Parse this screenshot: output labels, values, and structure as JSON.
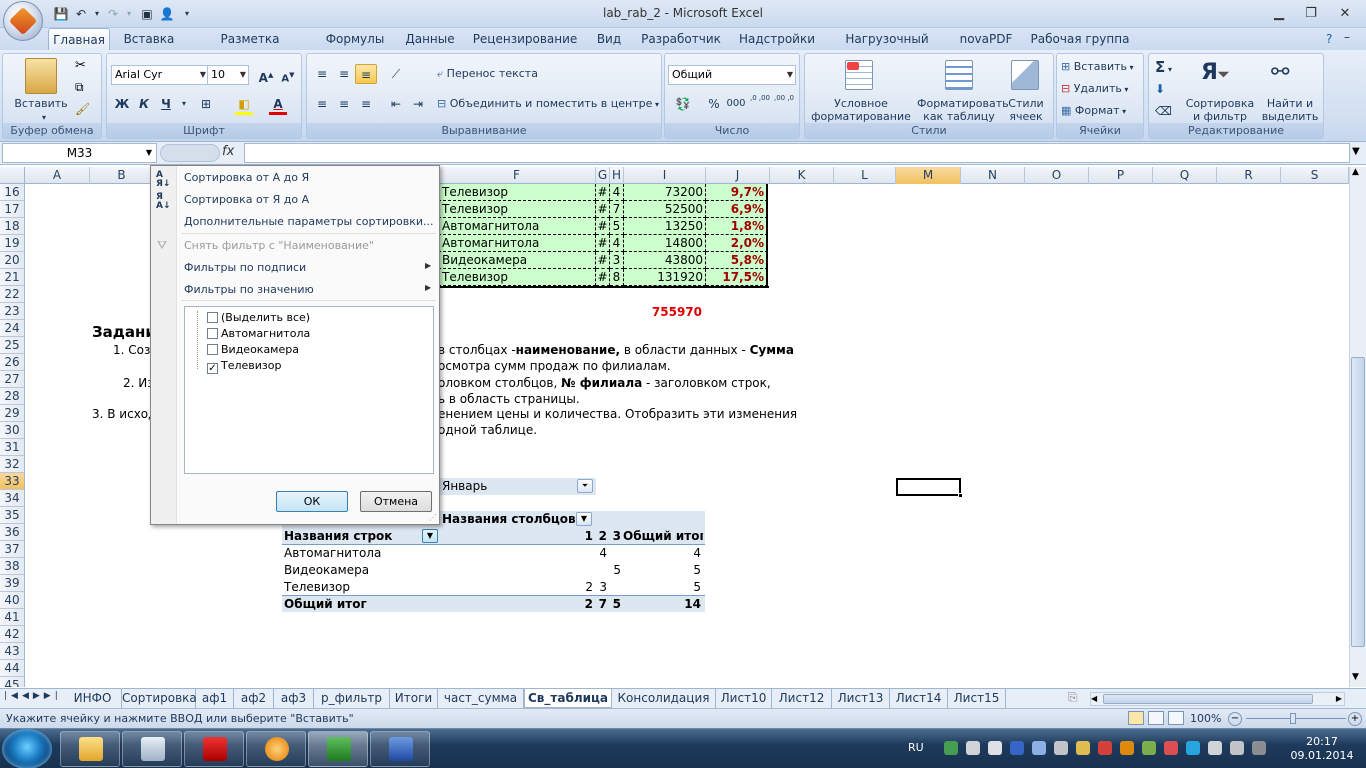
{
  "window": {
    "title": "lab_rab_2 - Microsoft Excel",
    "qat": [
      "save",
      "undo",
      "redo",
      "print-preview",
      "user"
    ]
  },
  "ribbon": {
    "tabs": [
      "Главная",
      "Вставка",
      "Разметка страницы",
      "Формулы",
      "Данные",
      "Рецензирование",
      "Вид",
      "Разработчик",
      "Надстройки",
      "Нагрузочный тест",
      "novaPDF",
      "Рабочая группа"
    ],
    "active_tab": "Главная",
    "groups": {
      "clipboard": {
        "label": "Буфер обмена",
        "paste": "Вставить"
      },
      "font": {
        "label": "Шрифт",
        "font_name": "Arial Cyr",
        "font_size": "10",
        "bold": "Ж",
        "italic": "К",
        "underline": "Ч"
      },
      "alignment": {
        "label": "Выравнивание",
        "wrap": "Перенос текста",
        "merge": "Объединить и поместить в центре"
      },
      "number": {
        "label": "Число",
        "format": "Общий",
        "percent": "%",
        "thousands": "000",
        "inc_dec": ",0 ,00",
        "dec_dec": ",00 ,0"
      },
      "styles": {
        "label": "Стили",
        "conditional": "Условное форматирование",
        "as_table": "Форматировать как таблицу",
        "cell_styles": "Стили ячеек"
      },
      "cells": {
        "label": "Ячейки",
        "insert": "Вставить",
        "delete": "Удалить",
        "format": "Формат"
      },
      "editing": {
        "label": "Редактирование",
        "sum": "Σ",
        "sort": "Сортировка и фильтр",
        "find": "Найти и выделить"
      }
    }
  },
  "formula_bar": {
    "name_box": "M33",
    "fx": "fx",
    "value": ""
  },
  "columns": [
    "A",
    "B",
    "C",
    "D",
    "E",
    "F",
    "G",
    "H",
    "I",
    "J",
    "K",
    "L",
    "M",
    "N",
    "O",
    "P",
    "Q",
    "R",
    "S"
  ],
  "rows": [
    "16",
    "17",
    "18",
    "19",
    "20",
    "21",
    "22",
    "23",
    "24",
    "25",
    "26",
    "27",
    "28",
    "29",
    "30",
    "31",
    "32",
    "33",
    "34",
    "35",
    "36",
    "37",
    "38",
    "39",
    "40",
    "41",
    "42",
    "43",
    "44",
    "45"
  ],
  "selected_cell": {
    "col": "M",
    "row": "33"
  },
  "data_table": [
    {
      "name": "Телевизор",
      "g": "#",
      "h": "4",
      "amount": "73200",
      "pct": "9,7%"
    },
    {
      "name": "Телевизор",
      "g": "#",
      "h": "7",
      "amount": "52500",
      "pct": "6,9%"
    },
    {
      "name": "Автомагнитола",
      "g": "#",
      "h": "5",
      "amount": "13250",
      "pct": "1,8%"
    },
    {
      "name": "Автомагнитола",
      "g": "#",
      "h": "4",
      "amount": "14800",
      "pct": "2,0%"
    },
    {
      "name": "Видеокамера",
      "g": "#",
      "h": "3",
      "amount": "43800",
      "pct": "5,8%"
    },
    {
      "name": "Телевизор",
      "g": "#",
      "h": "8",
      "amount": "131920",
      "pct": "17,5%"
    }
  ],
  "total_value": "755970",
  "task_text": {
    "r24": "Задани",
    "r25a": "1. Созд",
    "r25b_pre": "в столбцах -",
    "r25b_bold1": "наименование,",
    "r25b_mid": " в области данных - ",
    "r25b_bold2": "Сумма",
    "r26": "осмотра сумм продаж по филиалам.",
    "r27a": "2. Из",
    "r27b_pre": "оловком столбцов, ",
    "r27b_bold": "№ филиала",
    "r27b_post": " - заголовком строк,",
    "r28": "ь в область страницы.",
    "r29a": "3. В исход",
    "r29b": "енением цены и количества. Отобразить эти изменения",
    "r30": "одной таблице."
  },
  "pivot": {
    "page_filter_value": "Январь",
    "col_header": "Названия столбцов",
    "row_header": "Названия строк",
    "col_labels": [
      "1",
      "2",
      "3",
      "Общий итог"
    ],
    "rows": [
      {
        "label": "Автомагнитола",
        "c1": "",
        "c2": "4",
        "c3": "",
        "total": "4"
      },
      {
        "label": "Видеокамера",
        "c1": "",
        "c2": "",
        "c3": "5",
        "total": "5"
      },
      {
        "label": "Телевизор",
        "c1": "2",
        "c2": "3",
        "c3": "",
        "total": "5"
      }
    ],
    "grand_total": {
      "label": "Общий итог",
      "c1": "2",
      "c2": "7",
      "c3": "5",
      "total": "14"
    }
  },
  "filter_menu": {
    "sort_asc": "Сортировка от А до Я",
    "sort_desc": "Сортировка от Я до А",
    "sort_more": "Дополнительные параметры сортировки...",
    "clear_filter": "Снять фильтр с \"Наименование\"",
    "label_filters": "Фильтры по подписи",
    "value_filters": "Фильтры по значению",
    "items": [
      {
        "label": "(Выделить все)",
        "checked": false
      },
      {
        "label": "Автомагнитола",
        "checked": false
      },
      {
        "label": "Видеокамера",
        "checked": false
      },
      {
        "label": "Телевизор",
        "checked": true
      }
    ],
    "ok": "ОК",
    "cancel": "Отмена"
  },
  "sheet_tabs": [
    "ИНФО",
    "Сортировка",
    "аф1",
    "аф2",
    "аф3",
    "р_фильтр",
    "Итоги",
    "част_сумма",
    "Св_таблица",
    "Консолидация",
    "Лист10",
    "Лист12",
    "Лист13",
    "Лист14",
    "Лист15"
  ],
  "active_sheet": "Св_таблица",
  "status": {
    "text": "Укажите ячейку и нажмите ВВОД или выберите \"Вставить\"",
    "zoom": "100%"
  },
  "taskbar": {
    "lang": "RU",
    "time": "20:17",
    "date": "09.01.2014"
  },
  "colors": {
    "green_fill": "#ccffcc",
    "pct_red": "#a00000",
    "total_red": "#e00000",
    "selection_orange": "#f1c15f"
  }
}
